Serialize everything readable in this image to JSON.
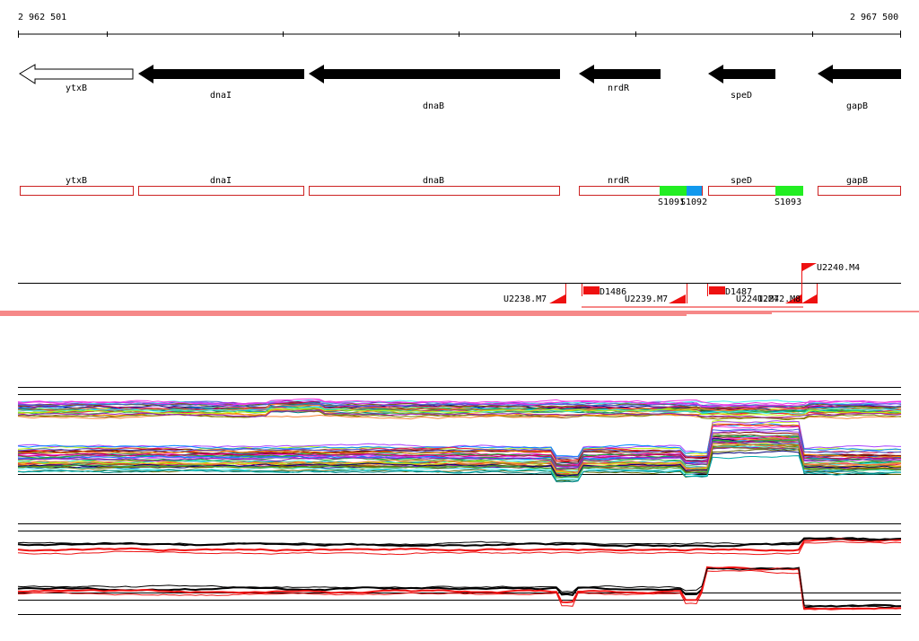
{
  "ruler": {
    "start_label": "2 962 501",
    "end_label": "2 967 500"
  },
  "genes": [
    {
      "name": "ytxB",
      "strand": "-",
      "style": "outline"
    },
    {
      "name": "dnaI",
      "strand": "-",
      "style": "filled"
    },
    {
      "name": "dnaB",
      "strand": "-",
      "style": "filled"
    },
    {
      "name": "nrdR",
      "strand": "-",
      "style": "filled"
    },
    {
      "name": "speD",
      "strand": "-",
      "style": "filled"
    },
    {
      "name": "gapB",
      "strand": "-",
      "style": "filled"
    }
  ],
  "cds_boxes": [
    {
      "name": "ytxB"
    },
    {
      "name": "dnaI"
    },
    {
      "name": "dnaB"
    },
    {
      "name": "nrdR"
    },
    {
      "name": "speD"
    },
    {
      "name": "gapB"
    }
  ],
  "features": [
    {
      "label": "S1091",
      "color": "#22ee22"
    },
    {
      "label": "S1092",
      "color": "#1199ee"
    },
    {
      "label": "S1093",
      "color": "#22ee22"
    }
  ],
  "upshifts": [
    {
      "label": "U2238.M7"
    },
    {
      "label": "U2239.M7"
    },
    {
      "label": "U2240.M4"
    },
    {
      "label": "U2241.M7"
    },
    {
      "label": "U2242.M8"
    }
  ],
  "downshifts": [
    {
      "label": "D1486"
    },
    {
      "label": "D1487"
    }
  ],
  "colors": {
    "gene_fill": "#000000",
    "cds_outline": "#cc2222",
    "signal_red": "#ee1111",
    "axis": "#000000"
  }
}
